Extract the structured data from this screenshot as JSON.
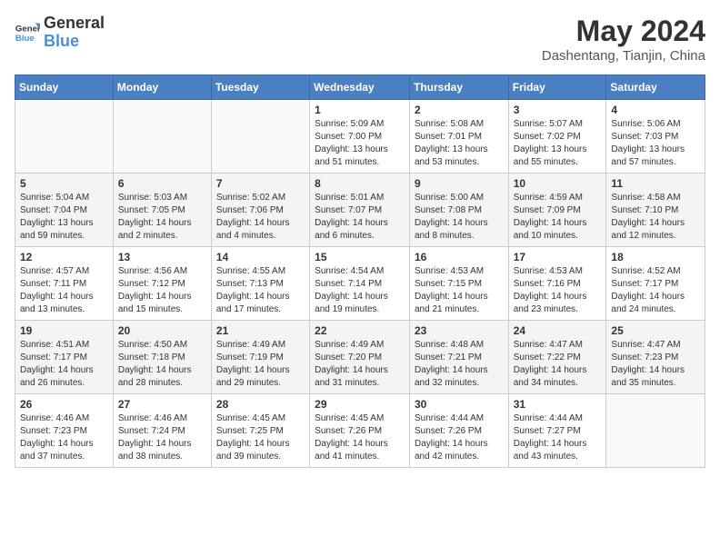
{
  "header": {
    "logo_line1": "General",
    "logo_line2": "Blue",
    "month_year": "May 2024",
    "location": "Dashentang, Tianjin, China"
  },
  "weekdays": [
    "Sunday",
    "Monday",
    "Tuesday",
    "Wednesday",
    "Thursday",
    "Friday",
    "Saturday"
  ],
  "weeks": [
    [
      {
        "day": "",
        "sunrise": "",
        "sunset": "",
        "daylight": ""
      },
      {
        "day": "",
        "sunrise": "",
        "sunset": "",
        "daylight": ""
      },
      {
        "day": "",
        "sunrise": "",
        "sunset": "",
        "daylight": ""
      },
      {
        "day": "1",
        "sunrise": "Sunrise: 5:09 AM",
        "sunset": "Sunset: 7:00 PM",
        "daylight": "Daylight: 13 hours and 51 minutes."
      },
      {
        "day": "2",
        "sunrise": "Sunrise: 5:08 AM",
        "sunset": "Sunset: 7:01 PM",
        "daylight": "Daylight: 13 hours and 53 minutes."
      },
      {
        "day": "3",
        "sunrise": "Sunrise: 5:07 AM",
        "sunset": "Sunset: 7:02 PM",
        "daylight": "Daylight: 13 hours and 55 minutes."
      },
      {
        "day": "4",
        "sunrise": "Sunrise: 5:06 AM",
        "sunset": "Sunset: 7:03 PM",
        "daylight": "Daylight: 13 hours and 57 minutes."
      }
    ],
    [
      {
        "day": "5",
        "sunrise": "Sunrise: 5:04 AM",
        "sunset": "Sunset: 7:04 PM",
        "daylight": "Daylight: 13 hours and 59 minutes."
      },
      {
        "day": "6",
        "sunrise": "Sunrise: 5:03 AM",
        "sunset": "Sunset: 7:05 PM",
        "daylight": "Daylight: 14 hours and 2 minutes."
      },
      {
        "day": "7",
        "sunrise": "Sunrise: 5:02 AM",
        "sunset": "Sunset: 7:06 PM",
        "daylight": "Daylight: 14 hours and 4 minutes."
      },
      {
        "day": "8",
        "sunrise": "Sunrise: 5:01 AM",
        "sunset": "Sunset: 7:07 PM",
        "daylight": "Daylight: 14 hours and 6 minutes."
      },
      {
        "day": "9",
        "sunrise": "Sunrise: 5:00 AM",
        "sunset": "Sunset: 7:08 PM",
        "daylight": "Daylight: 14 hours and 8 minutes."
      },
      {
        "day": "10",
        "sunrise": "Sunrise: 4:59 AM",
        "sunset": "Sunset: 7:09 PM",
        "daylight": "Daylight: 14 hours and 10 minutes."
      },
      {
        "day": "11",
        "sunrise": "Sunrise: 4:58 AM",
        "sunset": "Sunset: 7:10 PM",
        "daylight": "Daylight: 14 hours and 12 minutes."
      }
    ],
    [
      {
        "day": "12",
        "sunrise": "Sunrise: 4:57 AM",
        "sunset": "Sunset: 7:11 PM",
        "daylight": "Daylight: 14 hours and 13 minutes."
      },
      {
        "day": "13",
        "sunrise": "Sunrise: 4:56 AM",
        "sunset": "Sunset: 7:12 PM",
        "daylight": "Daylight: 14 hours and 15 minutes."
      },
      {
        "day": "14",
        "sunrise": "Sunrise: 4:55 AM",
        "sunset": "Sunset: 7:13 PM",
        "daylight": "Daylight: 14 hours and 17 minutes."
      },
      {
        "day": "15",
        "sunrise": "Sunrise: 4:54 AM",
        "sunset": "Sunset: 7:14 PM",
        "daylight": "Daylight: 14 hours and 19 minutes."
      },
      {
        "day": "16",
        "sunrise": "Sunrise: 4:53 AM",
        "sunset": "Sunset: 7:15 PM",
        "daylight": "Daylight: 14 hours and 21 minutes."
      },
      {
        "day": "17",
        "sunrise": "Sunrise: 4:53 AM",
        "sunset": "Sunset: 7:16 PM",
        "daylight": "Daylight: 14 hours and 23 minutes."
      },
      {
        "day": "18",
        "sunrise": "Sunrise: 4:52 AM",
        "sunset": "Sunset: 7:17 PM",
        "daylight": "Daylight: 14 hours and 24 minutes."
      }
    ],
    [
      {
        "day": "19",
        "sunrise": "Sunrise: 4:51 AM",
        "sunset": "Sunset: 7:17 PM",
        "daylight": "Daylight: 14 hours and 26 minutes."
      },
      {
        "day": "20",
        "sunrise": "Sunrise: 4:50 AM",
        "sunset": "Sunset: 7:18 PM",
        "daylight": "Daylight: 14 hours and 28 minutes."
      },
      {
        "day": "21",
        "sunrise": "Sunrise: 4:49 AM",
        "sunset": "Sunset: 7:19 PM",
        "daylight": "Daylight: 14 hours and 29 minutes."
      },
      {
        "day": "22",
        "sunrise": "Sunrise: 4:49 AM",
        "sunset": "Sunset: 7:20 PM",
        "daylight": "Daylight: 14 hours and 31 minutes."
      },
      {
        "day": "23",
        "sunrise": "Sunrise: 4:48 AM",
        "sunset": "Sunset: 7:21 PM",
        "daylight": "Daylight: 14 hours and 32 minutes."
      },
      {
        "day": "24",
        "sunrise": "Sunrise: 4:47 AM",
        "sunset": "Sunset: 7:22 PM",
        "daylight": "Daylight: 14 hours and 34 minutes."
      },
      {
        "day": "25",
        "sunrise": "Sunrise: 4:47 AM",
        "sunset": "Sunset: 7:23 PM",
        "daylight": "Daylight: 14 hours and 35 minutes."
      }
    ],
    [
      {
        "day": "26",
        "sunrise": "Sunrise: 4:46 AM",
        "sunset": "Sunset: 7:23 PM",
        "daylight": "Daylight: 14 hours and 37 minutes."
      },
      {
        "day": "27",
        "sunrise": "Sunrise: 4:46 AM",
        "sunset": "Sunset: 7:24 PM",
        "daylight": "Daylight: 14 hours and 38 minutes."
      },
      {
        "day": "28",
        "sunrise": "Sunrise: 4:45 AM",
        "sunset": "Sunset: 7:25 PM",
        "daylight": "Daylight: 14 hours and 39 minutes."
      },
      {
        "day": "29",
        "sunrise": "Sunrise: 4:45 AM",
        "sunset": "Sunset: 7:26 PM",
        "daylight": "Daylight: 14 hours and 41 minutes."
      },
      {
        "day": "30",
        "sunrise": "Sunrise: 4:44 AM",
        "sunset": "Sunset: 7:26 PM",
        "daylight": "Daylight: 14 hours and 42 minutes."
      },
      {
        "day": "31",
        "sunrise": "Sunrise: 4:44 AM",
        "sunset": "Sunset: 7:27 PM",
        "daylight": "Daylight: 14 hours and 43 minutes."
      },
      {
        "day": "",
        "sunrise": "",
        "sunset": "",
        "daylight": ""
      }
    ]
  ]
}
